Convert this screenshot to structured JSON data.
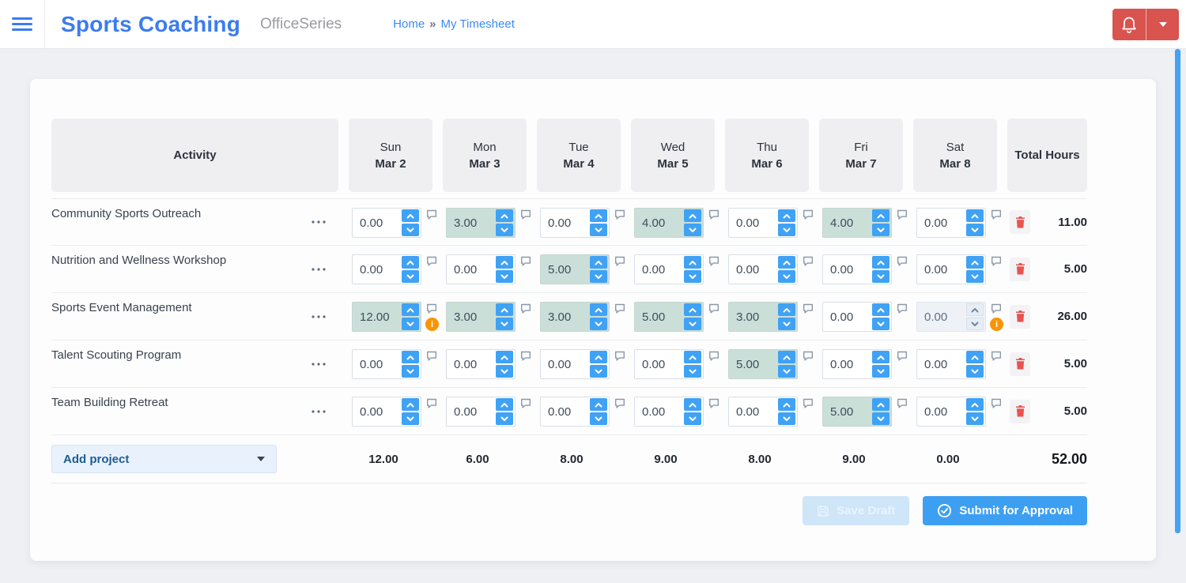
{
  "header": {
    "app_title": "Sports Coaching",
    "app_subtitle": "OfficeSeries",
    "breadcrumb": {
      "home": "Home",
      "separator": "»",
      "current": "My Timesheet"
    }
  },
  "table": {
    "activity_header": "Activity",
    "total_header": "Total Hours",
    "days": [
      {
        "day": "Sun",
        "date": "Mar 2"
      },
      {
        "day": "Mon",
        "date": "Mar 3"
      },
      {
        "day": "Tue",
        "date": "Mar 4"
      },
      {
        "day": "Wed",
        "date": "Mar 5"
      },
      {
        "day": "Thu",
        "date": "Mar 6"
      },
      {
        "day": "Fri",
        "date": "Mar 7"
      },
      {
        "day": "Sat",
        "date": "Mar 8"
      }
    ],
    "rows": [
      {
        "activity": "Community Sports Outreach",
        "total": "11.00",
        "cells": [
          {
            "value": "0.00"
          },
          {
            "value": "3.00",
            "highlighted": true
          },
          {
            "value": "0.00"
          },
          {
            "value": "4.00",
            "highlighted": true
          },
          {
            "value": "0.00"
          },
          {
            "value": "4.00",
            "highlighted": true
          },
          {
            "value": "0.00"
          }
        ]
      },
      {
        "activity": "Nutrition and Wellness Workshop",
        "total": "5.00",
        "cells": [
          {
            "value": "0.00"
          },
          {
            "value": "0.00"
          },
          {
            "value": "5.00",
            "highlighted": true
          },
          {
            "value": "0.00"
          },
          {
            "value": "0.00"
          },
          {
            "value": "0.00"
          },
          {
            "value": "0.00"
          }
        ]
      },
      {
        "activity": "Sports Event Management",
        "total": "26.00",
        "cells": [
          {
            "value": "12.00",
            "highlighted": true,
            "warning": true
          },
          {
            "value": "3.00",
            "highlighted": true
          },
          {
            "value": "3.00",
            "highlighted": true
          },
          {
            "value": "5.00",
            "highlighted": true
          },
          {
            "value": "3.00",
            "highlighted": true
          },
          {
            "value": "0.00"
          },
          {
            "value": "0.00",
            "disabled": true,
            "warning": true
          }
        ]
      },
      {
        "activity": "Talent Scouting Program",
        "total": "5.00",
        "cells": [
          {
            "value": "0.00"
          },
          {
            "value": "0.00"
          },
          {
            "value": "0.00"
          },
          {
            "value": "0.00"
          },
          {
            "value": "5.00",
            "highlighted": true
          },
          {
            "value": "0.00"
          },
          {
            "value": "0.00"
          }
        ]
      },
      {
        "activity": "Team Building Retreat",
        "total": "5.00",
        "cells": [
          {
            "value": "0.00"
          },
          {
            "value": "0.00"
          },
          {
            "value": "0.00"
          },
          {
            "value": "0.00"
          },
          {
            "value": "0.00"
          },
          {
            "value": "5.00",
            "highlighted": true
          },
          {
            "value": "0.00"
          }
        ]
      }
    ],
    "footer": {
      "add_project_label": "Add project",
      "day_totals": [
        "12.00",
        "6.00",
        "8.00",
        "9.00",
        "8.00",
        "9.00",
        "0.00"
      ],
      "grand_total": "52.00"
    }
  },
  "actions": {
    "save_draft_label": "Save Draft",
    "submit_label": "Submit for Approval"
  },
  "icons": {
    "menu": "hamburger-icon",
    "notifications": "bell-icon",
    "account": "caret-down-icon",
    "row_menu": "ellipsis-icon",
    "cell_note": "comment-bubble-icon",
    "cell_alert": "info-circle-icon",
    "delete_row": "trash-icon",
    "save": "floppy-disk-icon",
    "submit": "check-circle-icon",
    "spinner": [
      "chevron-up-icon",
      "chevron-down-icon"
    ]
  },
  "colors": {
    "brand_blue": "#3b7cf0",
    "link_blue": "#3d8af0",
    "accent_blue": "#3fa2f5",
    "danger_red": "#d9534f",
    "trash_red": "#e8534e",
    "highlight_cell": "#cbdfd9",
    "warning_orange": "#f89406",
    "page_bg": "#eef0f4",
    "scrollbar_blue": "#42a3f7"
  }
}
